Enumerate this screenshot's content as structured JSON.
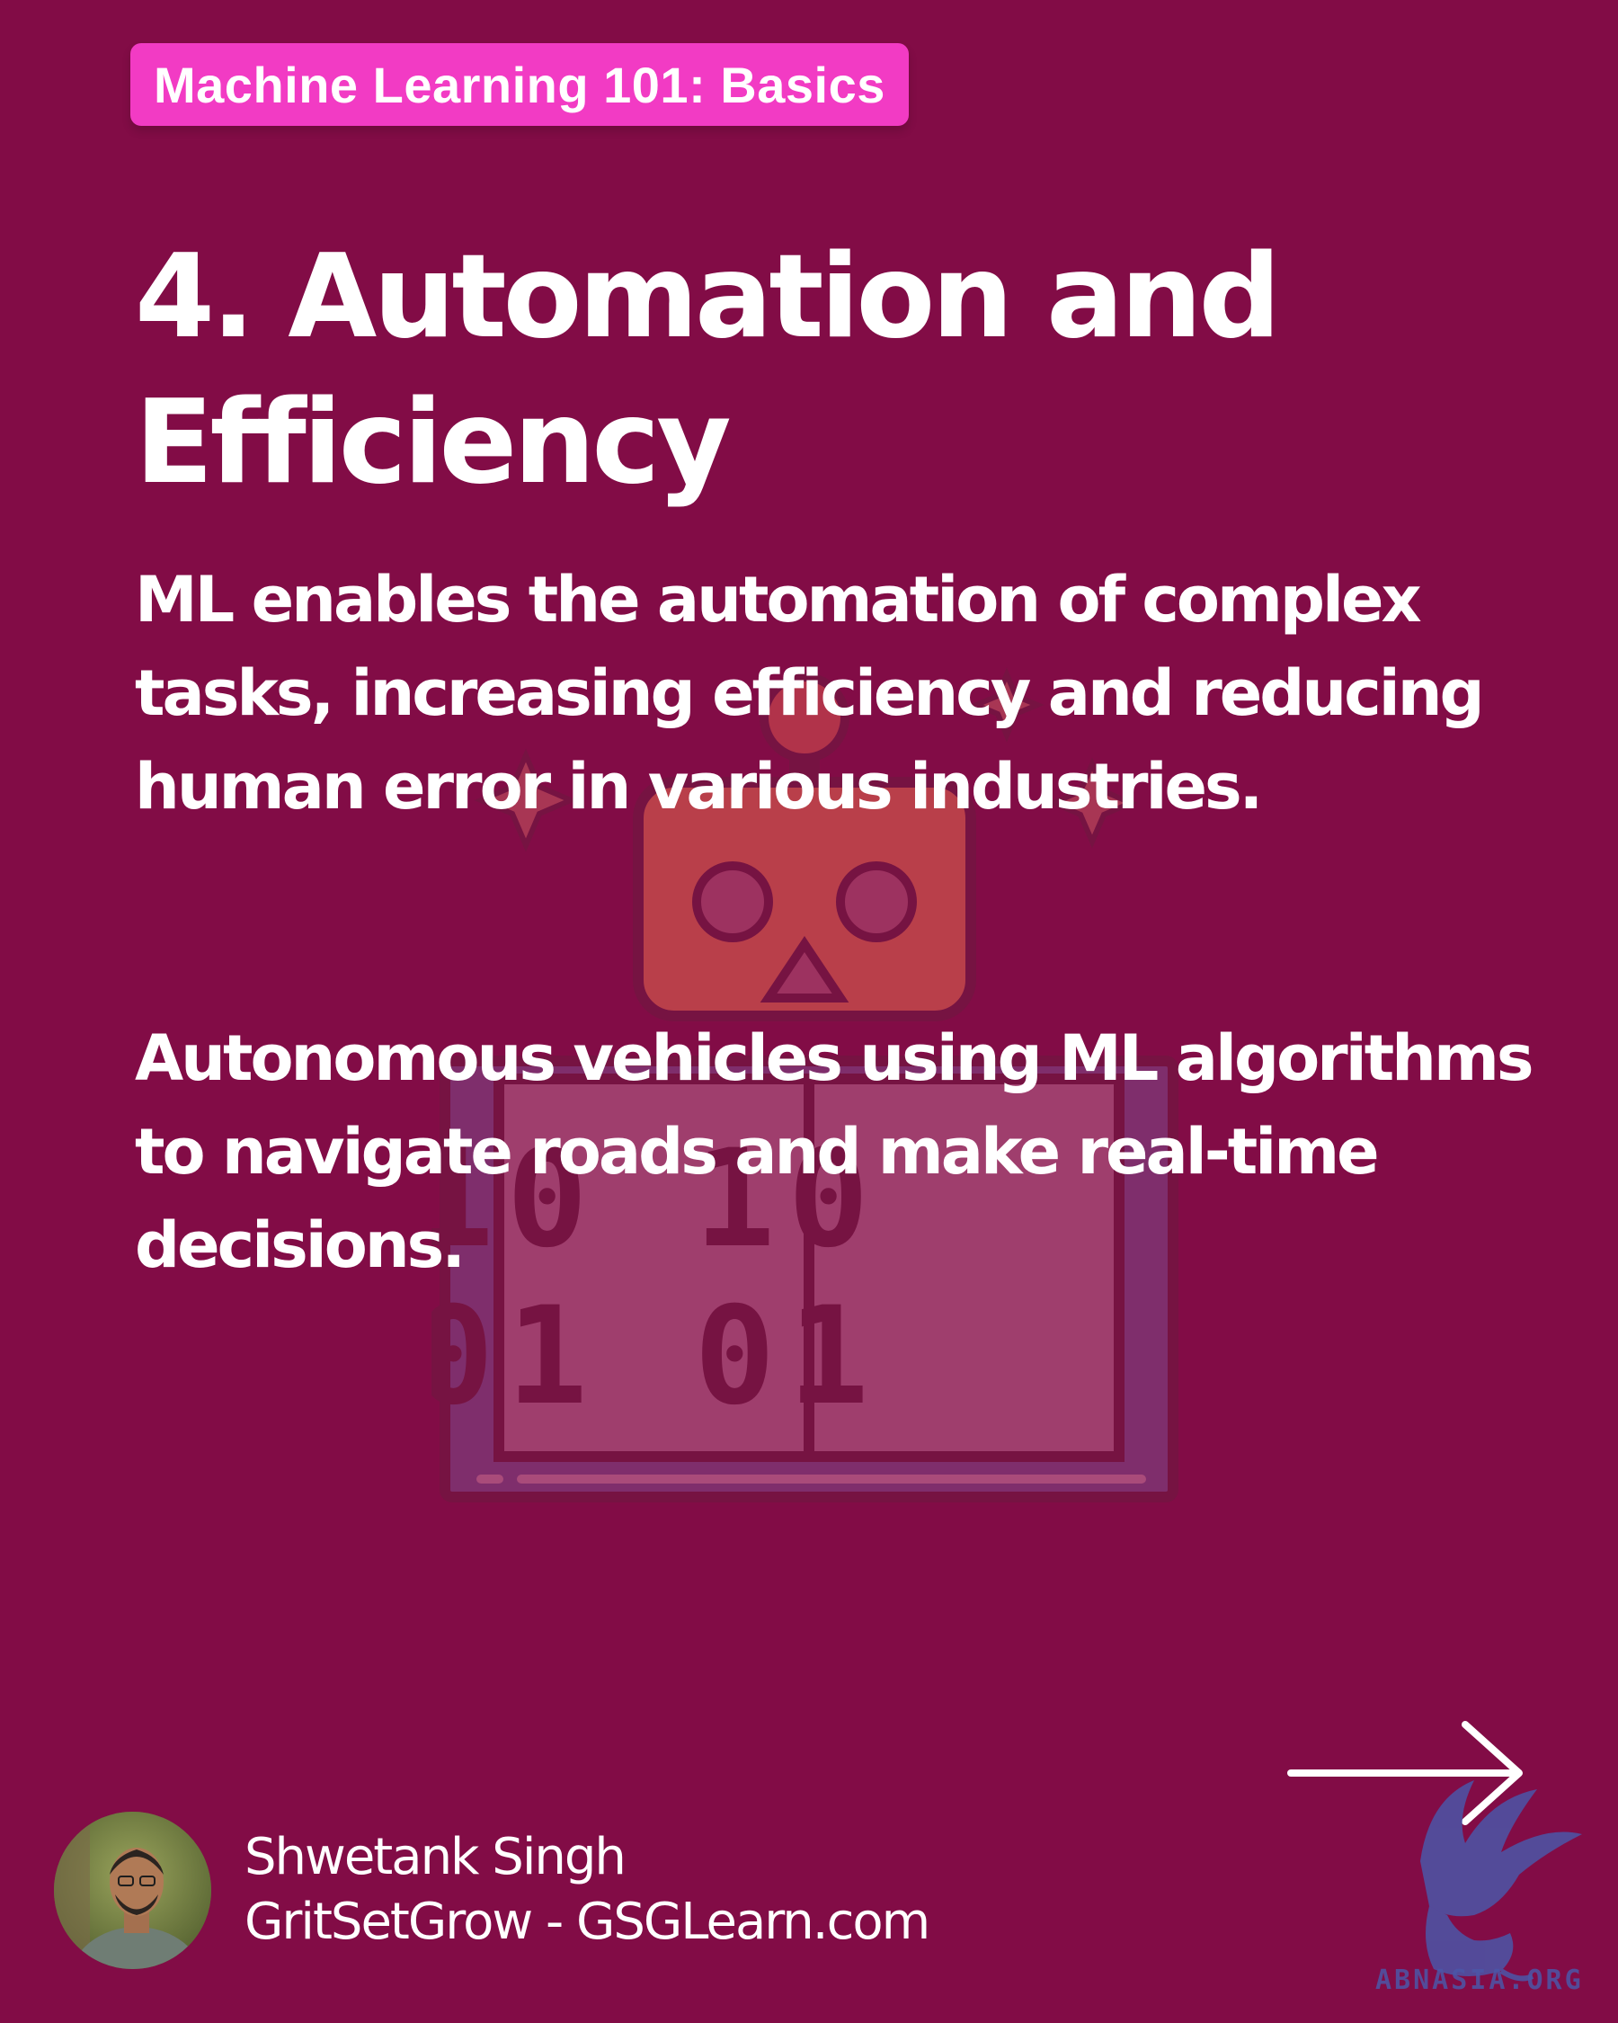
{
  "badge": {
    "label": "Machine Learning 101: Basics"
  },
  "slide": {
    "title": "4. Automation and Efficiency",
    "paragraph_1": "ML enables the automation of complex tasks, increasing efficiency and reducing human error in various industries.",
    "paragraph_2": "Autonomous vehicles using ML algorithms to navigate roads and make real-time decisions."
  },
  "illustration": {
    "binary_top": "10 10",
    "binary_bottom": "01 01"
  },
  "author": {
    "name": "Shwetank Singh",
    "site": "GritSetGrow - GSGLearn.com"
  },
  "watermark": {
    "text": "ABNASIA.ORG"
  },
  "colors": {
    "background": "#820c46",
    "badge": "#f23bc4",
    "text": "#ffffff",
    "watermark": "#4b56a8"
  },
  "icons": {
    "next": "arrow-right-icon",
    "background": "robot-binary-illustration",
    "watermark": "griffin-logo"
  }
}
